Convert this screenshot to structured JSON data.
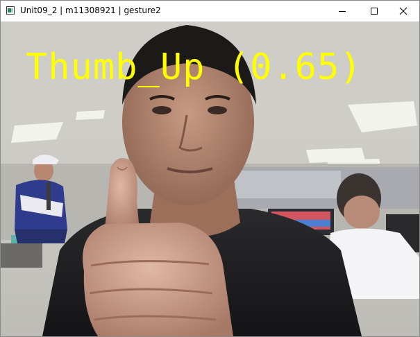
{
  "window": {
    "title": "Unit09_2 | m11308921 | gesture2",
    "controls": {
      "minimize_icon": "minimize-icon",
      "maximize_icon": "maximize-icon",
      "close_icon": "close-icon"
    }
  },
  "camera_feed": {
    "overlay_text": "Thumb_Up (0.65)",
    "overlay_color": "#ffff00"
  }
}
